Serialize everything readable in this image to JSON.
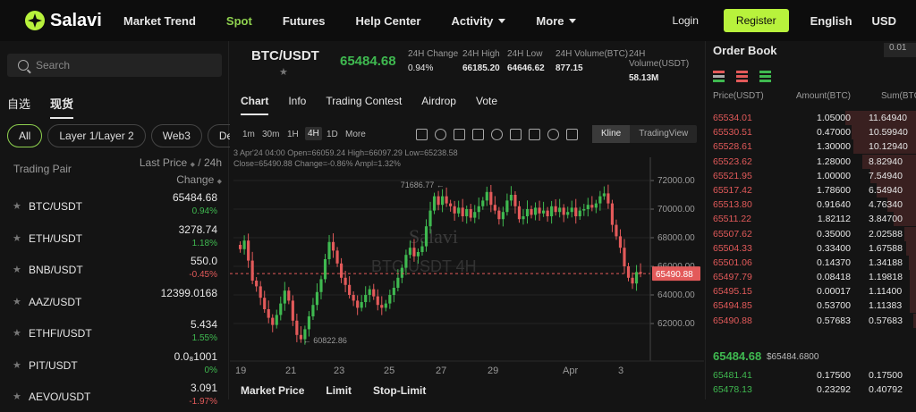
{
  "header": {
    "brand": "Salavi",
    "nav": [
      {
        "label": "Market Trend",
        "active": false,
        "dropdown": false
      },
      {
        "label": "Spot",
        "active": true,
        "dropdown": false
      },
      {
        "label": "Futures",
        "active": false,
        "dropdown": false
      },
      {
        "label": "Help Center",
        "active": false,
        "dropdown": false
      },
      {
        "label": "Activity",
        "active": false,
        "dropdown": true
      },
      {
        "label": "More",
        "active": false,
        "dropdown": true
      }
    ],
    "login": "Login",
    "register": "Register",
    "language": "English",
    "currency": "USD",
    "accent": "#b8f23c"
  },
  "markets": {
    "search_placeholder": "Search",
    "tabs": [
      {
        "label": "自选",
        "active": false
      },
      {
        "label": "现货",
        "active": true
      }
    ],
    "chips": [
      {
        "label": "All",
        "active": true
      },
      {
        "label": "Layer 1/Layer 2",
        "active": false
      },
      {
        "label": "Web3",
        "active": false
      },
      {
        "label": "DeFi",
        "active": false
      }
    ],
    "col_pair": "Trading Pair",
    "col_price": "Last Price",
    "col_period": "/ 24h",
    "col_change": "Change",
    "pairs": [
      {
        "name": "BTC/USDT",
        "price": "65484.68",
        "change": "0.94%",
        "dir": "up"
      },
      {
        "name": "ETH/USDT",
        "price": "3278.74",
        "change": "1.18%",
        "dir": "up"
      },
      {
        "name": "BNB/USDT",
        "price": "550.0",
        "change": "-0.45%",
        "dir": "down"
      },
      {
        "name": "AAZ/USDT",
        "price": "12399.0168",
        "change": "",
        "dir": "up"
      },
      {
        "name": "ETHFI/USDT",
        "price": "5.434",
        "change": "1.55%",
        "dir": "up"
      },
      {
        "name": "PIT/USDT",
        "price": "0.0₈1001",
        "change": "0%",
        "dir": "up"
      },
      {
        "name": "AEVO/USDT",
        "price": "3.091",
        "change": "-1.97%",
        "dir": "down"
      }
    ]
  },
  "ticker": {
    "pair": "BTC/USDT",
    "price": "65484.68",
    "stats": [
      {
        "label": "24H Change",
        "value": "0.94%",
        "dir": "up"
      },
      {
        "label": "24H High",
        "value": "66185.20",
        "dir": ""
      },
      {
        "label": "24H Low",
        "value": "64646.62",
        "dir": ""
      },
      {
        "label": "24H Volume(BTC)",
        "value": "877.15",
        "dir": ""
      },
      {
        "label": "24H Volume(USDT)",
        "value": "58.13M",
        "dir": ""
      }
    ]
  },
  "chart_tabs": [
    {
      "label": "Chart",
      "active": true
    },
    {
      "label": "Info",
      "active": false
    },
    {
      "label": "Trading Contest",
      "active": false
    },
    {
      "label": "Airdrop",
      "active": false
    },
    {
      "label": "Vote",
      "active": false
    }
  ],
  "intervals": [
    {
      "label": "1m",
      "active": false
    },
    {
      "label": "30m",
      "active": false
    },
    {
      "label": "1H",
      "active": false
    },
    {
      "label": "4H",
      "active": true
    },
    {
      "label": "1D",
      "active": false
    },
    {
      "label": "More",
      "active": false
    }
  ],
  "views": [
    {
      "label": "Kline",
      "active": true
    },
    {
      "label": "TradingView",
      "active": false
    }
  ],
  "tool_icons": [
    "indicators-icon",
    "pencil-icon",
    "line-chart-icon",
    "settings-icon",
    "calendar-icon",
    "layers-icon",
    "camera-icon",
    "expand-icon",
    "grid-icon"
  ],
  "chart_info": {
    "line1": "3 Apr'24 04:00   Open=66059.24   High=66097.29   Low=65238.58",
    "line2": "Close=65490.88   Change=-0.86%   Ampl=1.32%"
  },
  "chart_data": {
    "type": "candlestick",
    "watermark_brand": "Salavi",
    "watermark_pair": "BTC/USDT 4H",
    "y_ticks": [
      "72000.00",
      "70000.00",
      "68000.00",
      "66000.00",
      "64000.00",
      "62000.00"
    ],
    "ylim": [
      60000,
      73000
    ],
    "x_ticks": [
      "19",
      "21",
      "23",
      "25",
      "27",
      "29",
      "Apr",
      "3"
    ],
    "high_label": "71686.77",
    "low_label": "60822.86",
    "last_price": "65490.88",
    "last_value": 65490.88,
    "high_value": 71686.77,
    "low_value": 60822.86,
    "up_color": "#3fb950",
    "down_color": "#e35a5a",
    "closes": [
      67200,
      67800,
      66400,
      65000,
      64600,
      63800,
      63000,
      62400,
      61900,
      62600,
      63400,
      64300,
      63600,
      62200,
      61200,
      60900,
      61600,
      62500,
      63300,
      64200,
      65100,
      66500,
      67700,
      67100,
      66200,
      65200,
      64700,
      64000,
      63600,
      63100,
      63500,
      64000,
      64400,
      63900,
      63300,
      63100,
      63400,
      64000,
      64500,
      65200,
      65900,
      66800,
      67300,
      66700,
      67000,
      67400,
      68800,
      69900,
      70900,
      70300,
      70900,
      70400,
      70200,
      69700,
      70100,
      69500,
      70000,
      69400,
      69800,
      70200,
      70600,
      71200,
      70300,
      69900,
      69300,
      69800,
      70600,
      71000,
      70200,
      69300,
      69500,
      70000,
      69600,
      70100,
      69700,
      69900,
      69500,
      70200,
      69800,
      70100,
      69600,
      69800,
      70100,
      69500,
      69900,
      70000,
      70300,
      70100,
      70400,
      70900,
      71100,
      70400,
      68900,
      68100,
      67300,
      66000,
      65200,
      64800,
      65600,
      65490.88
    ]
  },
  "order_tabs": [
    "Market Price",
    "Limit",
    "Stop-Limit"
  ],
  "order_book": {
    "title": "Order Book",
    "precision": "0.01",
    "col_price": "Price(USDT)",
    "col_amount": "Amount(BTC)",
    "col_sum": "Sum(BTC)",
    "asks": [
      {
        "price": "65534.01",
        "amount": "1.05000",
        "sum": "11.64940",
        "depth": 0.34
      },
      {
        "price": "65530.51",
        "amount": "0.47000",
        "sum": "10.59940",
        "depth": 0.31
      },
      {
        "price": "65528.61",
        "amount": "1.30000",
        "sum": "10.12940",
        "depth": 0.3
      },
      {
        "price": "65523.62",
        "amount": "1.28000",
        "sum": "8.82940",
        "depth": 0.26
      },
      {
        "price": "65521.95",
        "amount": "1.00000",
        "sum": "7.54940",
        "depth": 0.22
      },
      {
        "price": "65517.42",
        "amount": "1.78600",
        "sum": "6.54940",
        "depth": 0.19
      },
      {
        "price": "65513.80",
        "amount": "0.91640",
        "sum": "4.76340",
        "depth": 0.14
      },
      {
        "price": "65511.22",
        "amount": "1.82112",
        "sum": "3.84700",
        "depth": 0.11
      },
      {
        "price": "65507.62",
        "amount": "0.35000",
        "sum": "2.02588",
        "depth": 0.06
      },
      {
        "price": "65504.33",
        "amount": "0.33400",
        "sum": "1.67588",
        "depth": 0.05
      },
      {
        "price": "65501.06",
        "amount": "0.14370",
        "sum": "1.34188",
        "depth": 0.04
      },
      {
        "price": "65497.79",
        "amount": "0.08418",
        "sum": "1.19818",
        "depth": 0.035
      },
      {
        "price": "65495.15",
        "amount": "0.00017",
        "sum": "1.11400",
        "depth": 0.033
      },
      {
        "price": "65494.85",
        "amount": "0.53700",
        "sum": "1.11383",
        "depth": 0.033
      },
      {
        "price": "65490.88",
        "amount": "0.57683",
        "sum": "0.57683",
        "depth": 0.017
      }
    ],
    "mid_price": "65484.68",
    "mid_usd": "$65484.6800",
    "bids": [
      {
        "price": "65481.41",
        "amount": "0.17500",
        "sum": "0.17500"
      },
      {
        "price": "65478.13",
        "amount": "0.23292",
        "sum": "0.40792"
      }
    ]
  }
}
